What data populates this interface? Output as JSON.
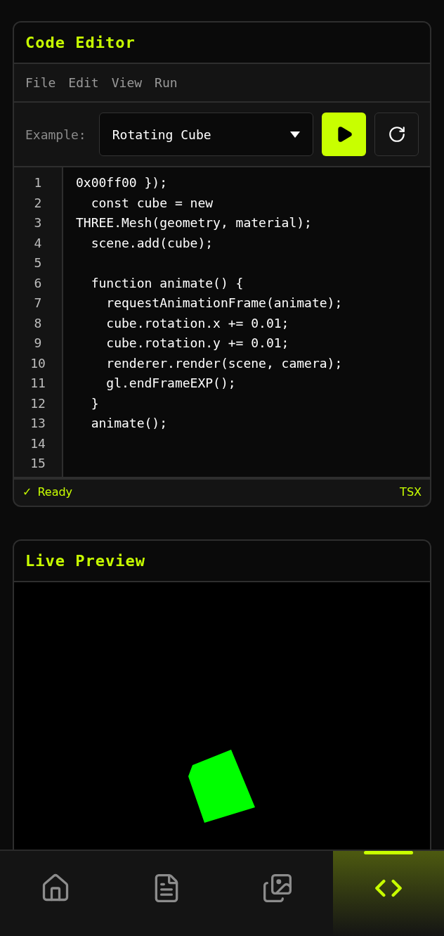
{
  "editor": {
    "title": "Code Editor",
    "menu": [
      "File",
      "Edit",
      "View",
      "Run"
    ],
    "example_label": "Example:",
    "example_select": {
      "value": "Rotating Cube"
    },
    "lines": [
      {
        "number": "1",
        "code": "0x00ff00 });"
      },
      {
        "number": "2",
        "code": "  const cube = new"
      },
      {
        "number": "3",
        "code": "THREE.Mesh(geometry, material);"
      },
      {
        "number": "4",
        "code": "  scene.add(cube);"
      },
      {
        "number": "5"
      },
      {
        "number": "6",
        "code": "  function animate() {"
      },
      {
        "number": "7",
        "code": "    requestAnimationFrame(animate);"
      },
      {
        "number": "8",
        "code": "    cube.rotation.x += 0.01;"
      },
      {
        "number": "9",
        "code": "    cube.rotation.y += 0.01;"
      },
      {
        "number": "10",
        "code": "    renderer.render(scene, camera);"
      },
      {
        "number": "11",
        "code": "    gl.endFrameEXP();"
      },
      {
        "number": "12",
        "code": "  }"
      },
      {
        "number": "13",
        "code": "  animate();"
      },
      {
        "number": "14"
      },
      {
        "number": "15"
      }
    ],
    "status": {
      "icon": "✓",
      "text": "Ready",
      "language": "TSX"
    }
  },
  "preview": {
    "title": "Live Preview"
  },
  "nav": [
    {
      "kind": "home",
      "selected": false
    },
    {
      "kind": "document",
      "selected": false
    },
    {
      "kind": "gallery",
      "selected": false
    },
    {
      "kind": "code",
      "selected": true
    }
  ]
}
